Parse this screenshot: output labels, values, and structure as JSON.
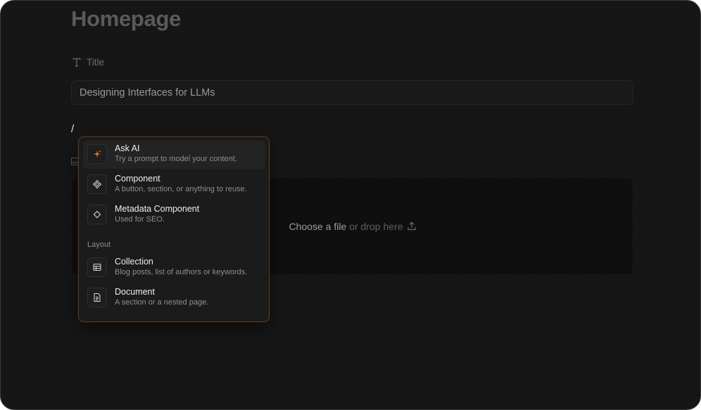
{
  "page": {
    "title": "Homepage"
  },
  "title_field": {
    "label": "Title",
    "value": "Designing Interfaces for LLMs"
  },
  "editor": {
    "slash": "/"
  },
  "dropzone": {
    "choose": "Choose a file",
    "or_drop": "or drop here"
  },
  "menu": {
    "items": [
      {
        "title": "Ask AI",
        "desc": "Try a prompt to model your content.",
        "icon": "sparkle-icon"
      },
      {
        "title": "Component",
        "desc": "A button, section, or anything to reuse.",
        "icon": "component-icon"
      },
      {
        "title": "Metadata Component",
        "desc": "Used for SEO.",
        "icon": "diamond-icon"
      }
    ],
    "section_label": "Layout",
    "layout_items": [
      {
        "title": "Collection",
        "desc": "Blog posts, list of authors or keywords.",
        "icon": "table-icon"
      },
      {
        "title": "Document",
        "desc": "A section or a nested page.",
        "icon": "document-icon"
      }
    ]
  },
  "colors": {
    "background": "#161616",
    "accent": "#e8742c",
    "menu_border": "#5a3a22"
  }
}
